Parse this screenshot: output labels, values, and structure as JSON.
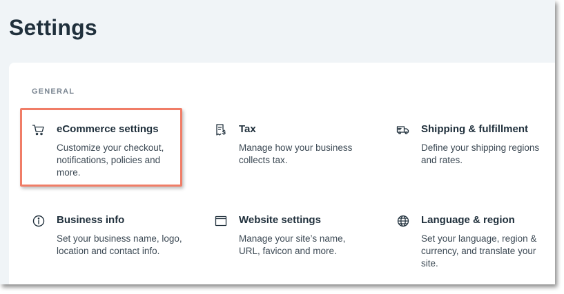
{
  "page": {
    "title": "Settings"
  },
  "section": {
    "label": "GENERAL"
  },
  "items": [
    {
      "title": "eCommerce settings",
      "desc": "Customize your checkout, notifications, policies and more.",
      "icon": "cart-icon"
    },
    {
      "title": "Tax",
      "desc": "Manage how your business collects tax.",
      "icon": "receipt-dollar-icon"
    },
    {
      "title": "Shipping & fulfillment",
      "desc": "Define your shipping regions and rates.",
      "icon": "truck-icon"
    },
    {
      "title": "Business info",
      "desc": "Set your business name, logo, location and contact info.",
      "icon": "info-icon"
    },
    {
      "title": "Website settings",
      "desc": "Manage your site’s name, URL, favicon and more.",
      "icon": "browser-window-icon"
    },
    {
      "title": "Language & region",
      "desc": "Set your language, region & currency, and translate your site.",
      "icon": "globe-icon"
    }
  ],
  "colors": {
    "highlight": "#f07d67",
    "text": "#20303c",
    "background": "#f0f4f7"
  }
}
